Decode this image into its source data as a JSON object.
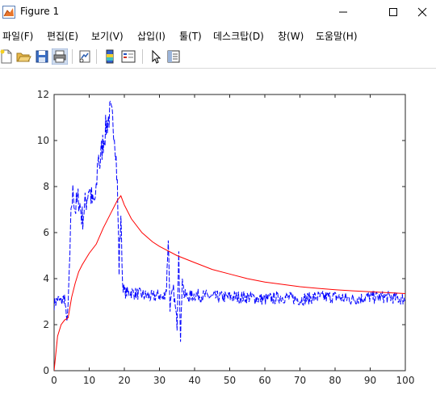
{
  "window": {
    "title": "Figure 1",
    "minimize_icon": "minimize-icon",
    "maximize_icon": "maximize-icon",
    "close_icon": "close-icon"
  },
  "menu": [
    {
      "label": "파일(F)"
    },
    {
      "label": "편집(E)"
    },
    {
      "label": "보기(V)"
    },
    {
      "label": "삽입(I)"
    },
    {
      "label": "툴(T)"
    },
    {
      "label": "데스크탑(D)"
    },
    {
      "label": "창(W)"
    },
    {
      "label": "도움말(H)"
    }
  ],
  "toolbar": {
    "icons": [
      "new-figure-icon",
      "open-file-icon",
      "save-icon",
      "print-icon",
      "link-plot-icon",
      "insert-colorbar-icon",
      "insert-legend-icon",
      "edit-plot-icon",
      "property-inspector-icon"
    ]
  },
  "colors": {
    "series_blue": "#0000ff",
    "series_red": "#ff0000"
  },
  "chart_data": {
    "type": "line",
    "xlim": [
      0,
      100
    ],
    "ylim": [
      0,
      12
    ],
    "xticks": [
      0,
      10,
      20,
      30,
      40,
      50,
      60,
      70,
      80,
      90,
      100
    ],
    "yticks": [
      0,
      2,
      4,
      6,
      8,
      10,
      12
    ],
    "grid": false,
    "series": [
      {
        "style": "dashed",
        "color": "blue",
        "x": [
          0,
          1,
          2,
          3,
          3.5,
          4,
          4.5,
          5,
          5.5,
          6,
          7,
          8,
          9,
          10,
          11,
          12,
          12.5,
          13,
          14,
          15,
          16,
          17,
          17.5,
          18,
          18.5,
          19,
          19.5,
          20,
          22,
          25,
          28,
          30,
          31,
          32,
          32.5,
          33,
          33.5,
          34,
          35,
          35.5,
          36,
          36.5,
          37,
          38,
          40,
          45,
          50,
          55,
          60,
          65,
          70,
          75,
          80,
          85,
          90,
          95,
          100
        ],
        "y": [
          2.9,
          3.1,
          3.0,
          3.2,
          2.2,
          2.7,
          5.0,
          7.3,
          7.8,
          7.0,
          7.5,
          6.6,
          7.3,
          8.0,
          7.2,
          7.6,
          9.4,
          9.0,
          10.0,
          10.7,
          11.2,
          10.6,
          9.8,
          8.0,
          4.5,
          6.8,
          3.8,
          3.4,
          3.4,
          3.3,
          3.2,
          3.3,
          3.1,
          3.6,
          5.8,
          2.8,
          3.2,
          3.5,
          2.0,
          5.4,
          1.2,
          4.2,
          3.3,
          3.2,
          3.3,
          3.2,
          3.2,
          3.2,
          3.1,
          3.2,
          3.1,
          3.2,
          3.2,
          3.1,
          3.2,
          3.2,
          3.1
        ]
      },
      {
        "style": "solid",
        "color": "red",
        "x": [
          0,
          1,
          2,
          3,
          4,
          5,
          6,
          7,
          8,
          10,
          12,
          14,
          16,
          18,
          19,
          20,
          22,
          25,
          28,
          30,
          35,
          40,
          45,
          50,
          55,
          60,
          65,
          70,
          75,
          80,
          85,
          90,
          95,
          100
        ],
        "y": [
          0,
          1.5,
          2.0,
          2.2,
          2.3,
          3.2,
          3.8,
          4.3,
          4.6,
          5.1,
          5.5,
          6.2,
          6.8,
          7.4,
          7.6,
          7.2,
          6.6,
          6.0,
          5.6,
          5.4,
          5.0,
          4.7,
          4.4,
          4.2,
          4.0,
          3.85,
          3.75,
          3.65,
          3.58,
          3.52,
          3.47,
          3.43,
          3.39,
          3.35
        ]
      }
    ]
  }
}
